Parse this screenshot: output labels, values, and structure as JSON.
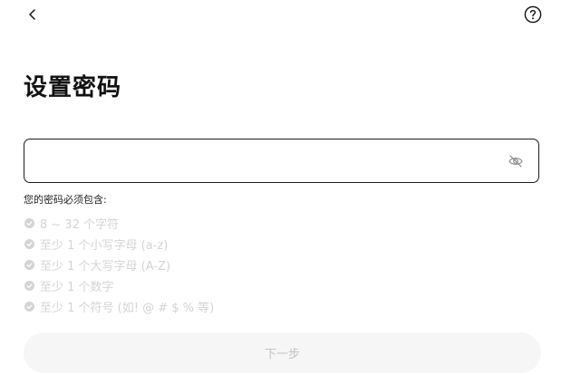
{
  "header": {
    "back_icon": "chevron-left-icon",
    "help_icon": "question-circle-icon"
  },
  "title": "设置密码",
  "password_field": {
    "value": "",
    "placeholder": "",
    "visibility_icon": "eye-off-icon"
  },
  "requirements": {
    "heading": "您的密码必须包含:",
    "items": [
      {
        "label": "8 ~ 32 个字符"
      },
      {
        "label": "至少 1 个小写字母 (a-z)"
      },
      {
        "label": "至少 1 个大写字母 (A-Z)"
      },
      {
        "label": "至少 1 个数字"
      },
      {
        "label": "至少 1 个符号 (如!  @ # $ % 等)"
      }
    ],
    "unmet_color": "#d4d4d4"
  },
  "next_button": {
    "label": "下一步",
    "disabled_bg": "#f6f6f6",
    "disabled_text": "#c2c2c2"
  }
}
